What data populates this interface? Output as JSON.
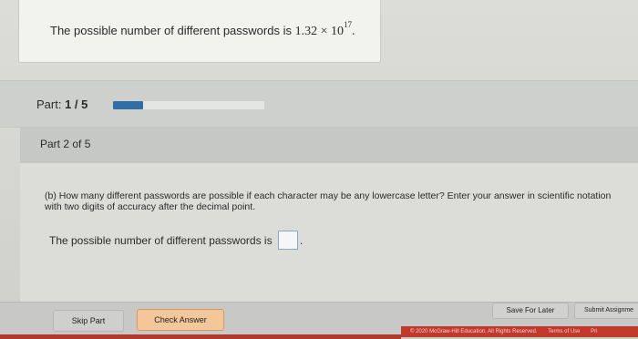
{
  "part_a": {
    "prefix": "The possible number of different passwords is ",
    "mantissa": "1.32",
    "times": " × 10",
    "exponent": "17",
    "suffix": "."
  },
  "progress": {
    "part_label": "Part:",
    "part_value": "1 / 5",
    "fraction": 0.2
  },
  "part_header": "Part 2 of 5",
  "question": {
    "text": "(b) How many different passwords are possible if each character may be any lowercase letter? Enter your answer in scientific notation with two digits of accuracy after the decimal point.",
    "prompt": "The possible number of different passwords is",
    "trailing": "."
  },
  "footer": {
    "skip_label": "Skip Part",
    "check_label": "Check Answer",
    "save_label": "Save For Later",
    "submit_label": "Submit Assignme",
    "copyright": "© 2020 McGraw-Hill Education. All Rights Reserved.",
    "terms": "Terms of Use",
    "privacy": "Pri"
  },
  "colors": {
    "progress_fill": "#2f6fa6",
    "check_button": "#f3c79a",
    "footer_red": "#c0392b"
  }
}
